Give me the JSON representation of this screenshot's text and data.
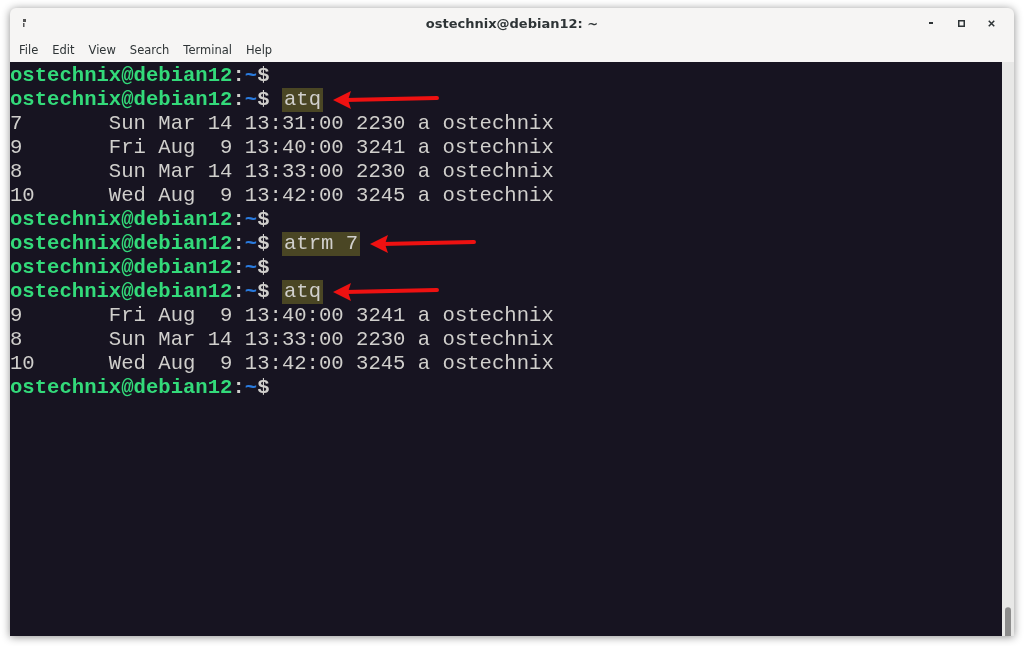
{
  "window": {
    "title": "ostechnix@debian12: ~"
  },
  "menu": [
    "File",
    "Edit",
    "View",
    "Search",
    "Terminal",
    "Help"
  ],
  "terminal": {
    "lines": [
      {
        "kind": "prompt",
        "user_host": "ostechnix@debian12",
        "separator": ":",
        "path": "~",
        "symbol": "$"
      },
      {
        "kind": "prompt",
        "user_host": "ostechnix@debian12",
        "separator": ":",
        "path": "~",
        "symbol": "$",
        "command": "atq",
        "highlighted": true
      },
      {
        "kind": "output",
        "text": "7       Sun Mar 14 13:31:00 2230 a ostechnix"
      },
      {
        "kind": "output",
        "text": "9       Fri Aug  9 13:40:00 3241 a ostechnix"
      },
      {
        "kind": "output",
        "text": "8       Sun Mar 14 13:33:00 2230 a ostechnix"
      },
      {
        "kind": "output",
        "text": "10      Wed Aug  9 13:42:00 3245 a ostechnix"
      },
      {
        "kind": "prompt",
        "user_host": "ostechnix@debian12",
        "separator": ":",
        "path": "~",
        "symbol": "$"
      },
      {
        "kind": "prompt",
        "user_host": "ostechnix@debian12",
        "separator": ":",
        "path": "~",
        "symbol": "$",
        "command": "atrm 7",
        "highlighted": true
      },
      {
        "kind": "prompt",
        "user_host": "ostechnix@debian12",
        "separator": ":",
        "path": "~",
        "symbol": "$"
      },
      {
        "kind": "prompt",
        "user_host": "ostechnix@debian12",
        "separator": ":",
        "path": "~",
        "symbol": "$",
        "command": "atq",
        "highlighted": true
      },
      {
        "kind": "output",
        "text": "9       Fri Aug  9 13:40:00 3241 a ostechnix"
      },
      {
        "kind": "output",
        "text": "8       Sun Mar 14 13:33:00 2230 a ostechnix"
      },
      {
        "kind": "output",
        "text": "10      Wed Aug  9 13:42:00 3245 a ostechnix"
      },
      {
        "kind": "prompt",
        "user_host": "ostechnix@debian12",
        "separator": ":",
        "path": "~",
        "symbol": "$"
      }
    ]
  }
}
